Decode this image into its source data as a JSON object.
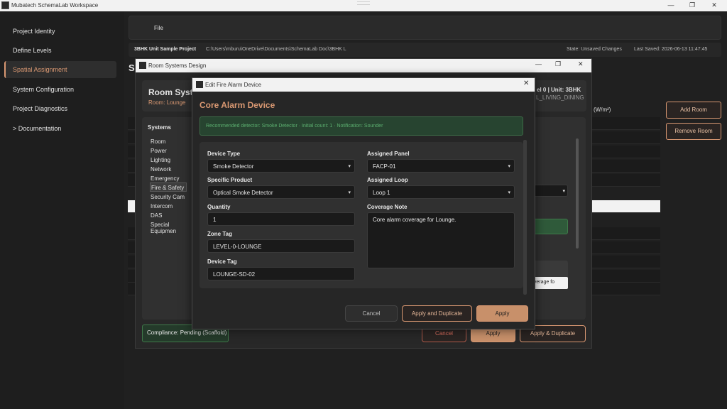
{
  "window": {
    "title": "Mubatech SchemaLab Workspace",
    "min": "—",
    "max": "❐",
    "close": "✕"
  },
  "sidebar": {
    "items": [
      {
        "label": "Project Identity"
      },
      {
        "label": "Define Levels"
      },
      {
        "label": "Spatial Assignment"
      },
      {
        "label": "System Configuration"
      },
      {
        "label": "Project Diagnostics"
      },
      {
        "label": ">   Documentation"
      }
    ]
  },
  "menu": {
    "file": "File"
  },
  "pathbar": {
    "project": "3BHK Unit Sample Project",
    "path": "C:\\Users\\mburu\\OneDrive\\Documents\\SchemaLab Doc\\3BHK L",
    "state": "State: Unsaved Changes",
    "saved": "Last Saved: 2026-06-13 11:47:45"
  },
  "background": {
    "heading": "S",
    "col_hint": "(W/m²)",
    "add_room": "Add Room",
    "remove_room": "Remove Room"
  },
  "rsd": {
    "title": "Room Systems Design",
    "heading": "Room Syste",
    "room": "Room: Lounge",
    "level": "el 0  |  Unit: 3BHK",
    "space": "L_LIVING_DINING",
    "systems_title": "Systems",
    "systems": [
      "Room",
      "Power",
      "Lighting",
      "Network",
      "Emergency",
      "Fire & Safety",
      "Security Cam",
      "Intercom",
      "DAS",
      "Special Equipmen"
    ],
    "note_partial": "te",
    "note_value": "overage fo",
    "compliance": "Compliance: Pending (Scaffold)",
    "cancel": "Cancel",
    "apply": "Apply",
    "apply_dup": "Apply & Duplicate"
  },
  "dialog": {
    "title": "Edit Fire Alarm Device",
    "heading": "Core Alarm Device",
    "recommendation": "Recommended detector: Smoke Detector · Initial count: 1 · Notification: Sounder",
    "device_type": {
      "label": "Device Type",
      "value": "Smoke Detector"
    },
    "specific_product": {
      "label": "Specific Product",
      "value": "Optical Smoke Detector"
    },
    "quantity": {
      "label": "Quantity",
      "value": "1"
    },
    "zone_tag": {
      "label": "Zone Tag",
      "value": "LEVEL-0-LOUNGE"
    },
    "device_tag": {
      "label": "Device Tag",
      "value": "LOUNGE-SD-02"
    },
    "assigned_panel": {
      "label": "Assigned Panel",
      "value": "FACP-01"
    },
    "assigned_loop": {
      "label": "Assigned Loop",
      "value": "Loop 1"
    },
    "coverage_note": {
      "label": "Coverage Note",
      "value": "Core alarm coverage for Lounge."
    },
    "cancel": "Cancel",
    "apply_dup": "Apply and Duplicate",
    "apply": "Apply",
    "close": "✕",
    "arrow": "▾"
  },
  "colors": {
    "accent": "#d99872",
    "bg": "#1a1a1a",
    "success": "#2f5a3a"
  }
}
